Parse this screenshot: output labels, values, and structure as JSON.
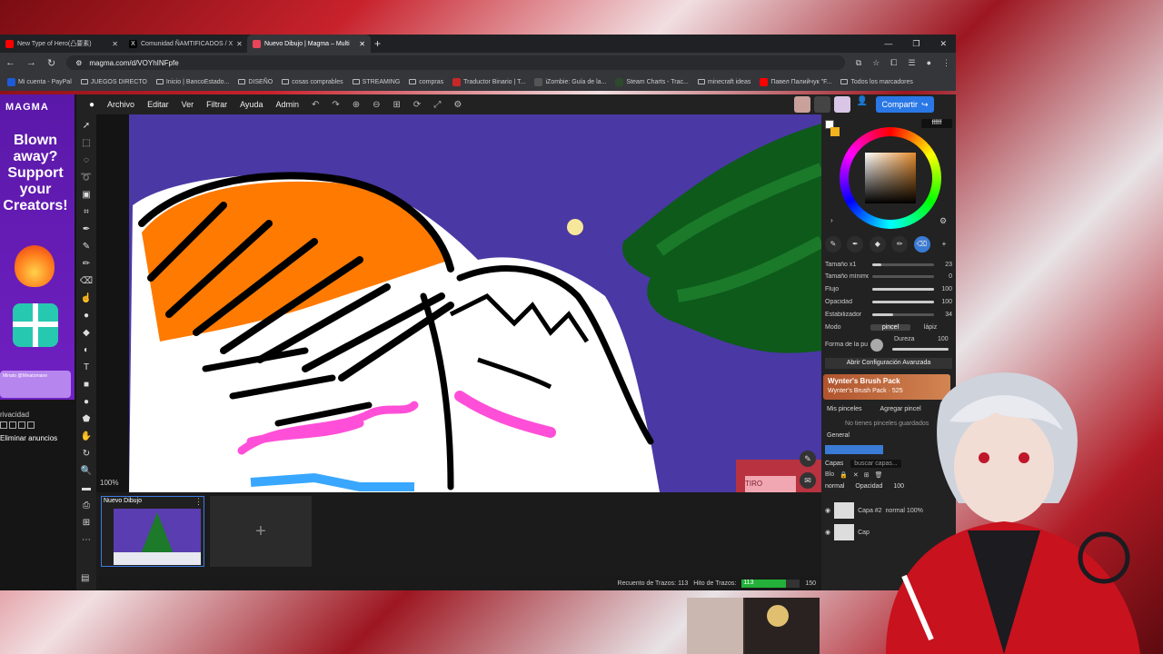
{
  "browser": {
    "tabs": [
      {
        "title": "New Type of Hero(凸要素)",
        "active": false,
        "fav": "#ff0000"
      },
      {
        "title": "Comunidad ÑAMTIFICADOS / X",
        "active": false,
        "fav": "#000000"
      },
      {
        "title": "Nuevo Dibujo | Magma – Multi",
        "active": true,
        "fav": "#e8445a"
      }
    ],
    "new_tab": "+",
    "url": "magma.com/d/VOYhINFpfe",
    "bookmarks": [
      "Mi cuenta - PayPal",
      "JUEGOS DIRECTO",
      "Inicio | BancoEstado...",
      "DISEÑO",
      "cosas comprables",
      "STREAMING",
      "compras",
      "Traductor Binario | T...",
      "iZombie: Guía de la...",
      "Steam Charts - Trac...",
      "minecraft ideas",
      "Павел Палийчук \"F...",
      "Todos los marcadores"
    ]
  },
  "ad": {
    "logo": "MAGMA",
    "headline": "Blown away? Support your Creators!",
    "card": "Minato @Minatomane",
    "privacy": "rivacidad",
    "remove": "Eliminar anuncios"
  },
  "menu": {
    "items": [
      "Archivo",
      "Editar",
      "Ver",
      "Filtrar",
      "Ayuda",
      "Admin"
    ],
    "share": "Compartir"
  },
  "canvas": {
    "zoom": "100%",
    "sign": "TIRO"
  },
  "drawings": {
    "doc_title": "Nuevo Dibujo",
    "new_symbol": "+"
  },
  "status": {
    "strokes_label": "Recuento de Trazos: 113",
    "limit_label": "Hito de Trazos:",
    "value": "113",
    "max": "150",
    "progress": 0.7533
  },
  "color": {
    "hex": "ffffff",
    "fg": "#ffffff",
    "bg": "#f2b11f"
  },
  "brush": {
    "params": [
      {
        "label": "Tamaño x1",
        "value": "23",
        "level": 0.15
      },
      {
        "label": "Tamaño mínimo",
        "value": "0",
        "level": 0.0
      },
      {
        "label": "Flujo",
        "value": "100",
        "level": 1.0
      },
      {
        "label": "Opacidad",
        "value": "100",
        "level": 1.0
      },
      {
        "label": "Estabilizador",
        "value": "34",
        "level": 0.34
      }
    ],
    "mode_label": "Modo",
    "modes": [
      "pincel",
      "lápiz"
    ],
    "shape_label": "Forma de la pu",
    "hardness_label": "Dureza",
    "hardness_value": "100",
    "advanced": "Abrir Configuración Avanzada",
    "pack_title": "Wynter's Brush Pack",
    "pack_sub": "Wynter's Brush Pack · 525",
    "my_brushes": "Mis pinceles",
    "add_brush": "Agregar pincel",
    "no_brushes": "No tienes pinceles guardados",
    "general": "General"
  },
  "layers": {
    "title": "Capas",
    "search": "buscar capas...",
    "blend": "normal",
    "opacity_label": "Opacidad",
    "opacity": "100",
    "blend_label": "Blo",
    "list": [
      {
        "name": "Capa #2",
        "detail": "normal 100%"
      },
      {
        "name": "Cap",
        "detail": ""
      }
    ]
  }
}
